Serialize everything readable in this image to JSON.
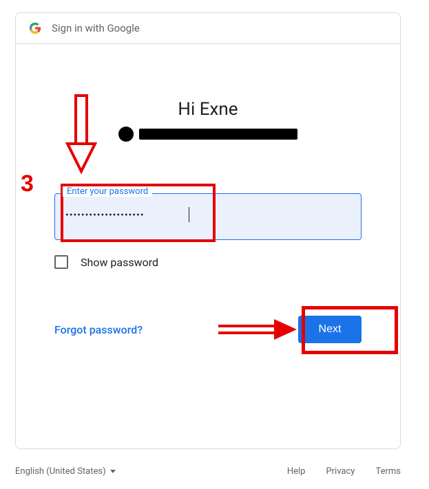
{
  "header": {
    "title": "Sign in with Google"
  },
  "greeting": "Hi Exne",
  "password": {
    "label": "Enter your password",
    "masked_value": "••••••••••••••••••••",
    "show_label": "Show password",
    "show_checked": false
  },
  "actions": {
    "forgot": "Forgot password?",
    "next": "Next"
  },
  "footer": {
    "language": "English (United States)",
    "help": "Help",
    "privacy": "Privacy",
    "terms": "Terms"
  },
  "annotations": {
    "step_number": "3"
  },
  "colors": {
    "accent": "#1a73e8",
    "annotation": "#e60000"
  }
}
